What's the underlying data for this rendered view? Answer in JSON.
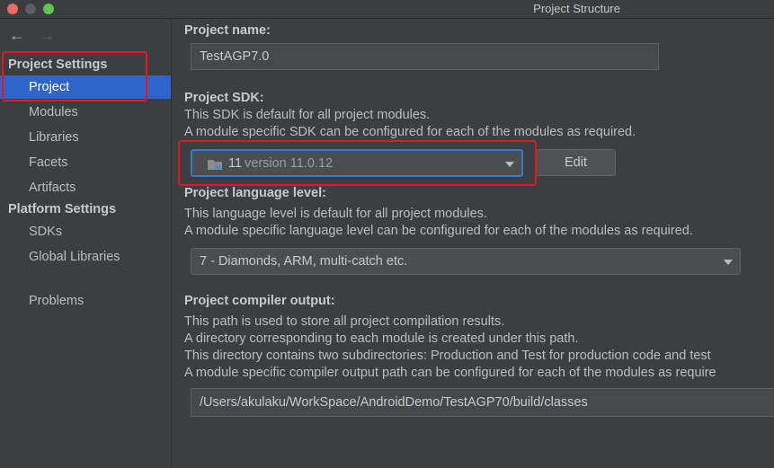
{
  "window": {
    "title": "Project Structure"
  },
  "sidebar": {
    "back_icon": "←",
    "forward_icon": "→",
    "project_settings_header": "Project Settings",
    "project_settings_items": [
      {
        "label": "Project"
      },
      {
        "label": "Modules"
      },
      {
        "label": "Libraries"
      },
      {
        "label": "Facets"
      },
      {
        "label": "Artifacts"
      }
    ],
    "platform_settings_header": "Platform Settings",
    "platform_settings_items": [
      {
        "label": "SDKs"
      },
      {
        "label": "Global Libraries"
      }
    ],
    "problems_label": "Problems"
  },
  "main": {
    "project_name": {
      "label": "Project name:",
      "value": "TestAGP7.0"
    },
    "project_sdk": {
      "label": "Project SDK:",
      "desc1": "This SDK is default for all project modules.",
      "desc2": "A module specific SDK can be configured for each of the modules as required.",
      "sdk_name": "11",
      "sdk_version": "version 11.0.12",
      "edit_label": "Edit"
    },
    "language_level": {
      "label": "Project language level:",
      "desc1": "This language level is default for all project modules.",
      "desc2": "A module specific language level can be configured for each of the modules as required.",
      "value": "7 - Diamonds, ARM, multi-catch etc."
    },
    "compiler_output": {
      "label": "Project compiler output:",
      "desc1": "This path is used to store all project compilation results.",
      "desc2": "A directory corresponding to each module is created under this path.",
      "desc3": "This directory contains two subdirectories: Production and Test for production code and test",
      "desc4": "A module specific compiler output path can be configured for each of the modules as require",
      "value": "/Users/akulaku/WorkSpace/AndroidDemo/TestAGP70/build/classes"
    }
  },
  "colors": {
    "selection": "#2f65ca",
    "highlight_box": "#e5171e",
    "focus_border": "#3d79c4"
  }
}
